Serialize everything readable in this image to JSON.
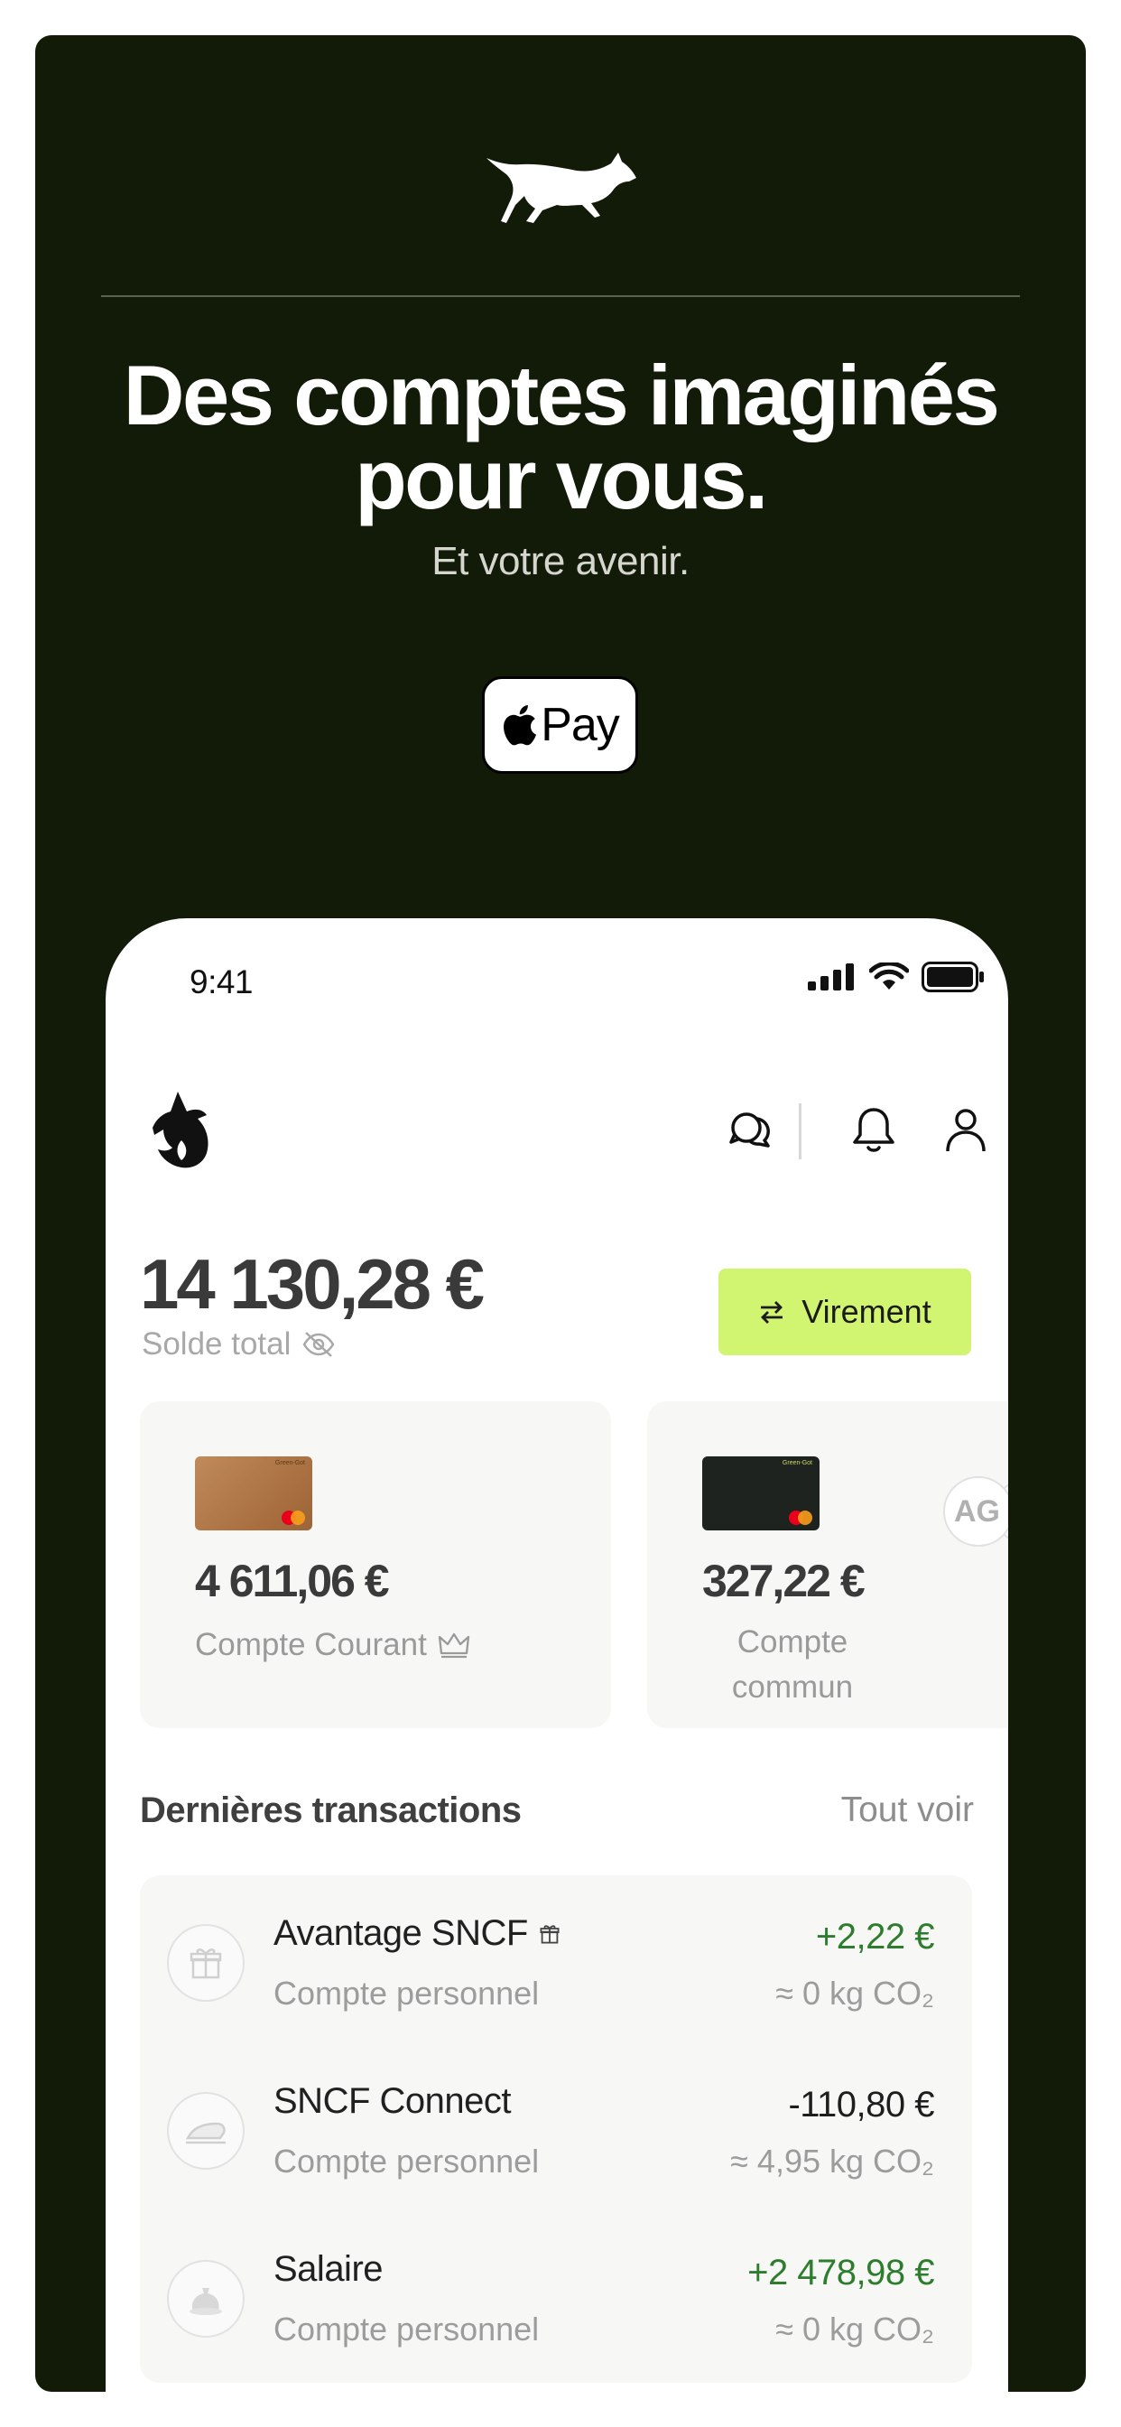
{
  "hero": {
    "title_line1": "Des comptes imaginés",
    "title_line2": "pour vous.",
    "subtitle": "Et votre avenir.",
    "apple_pay_label": "Pay"
  },
  "status_bar": {
    "time": "9:41"
  },
  "app": {
    "balance": "14 130,28 €",
    "balance_label": "Solde total",
    "transfer_button": "Virement",
    "accounts": [
      {
        "amount": "4 611,06 €",
        "name": "Compte Courant",
        "card_brand": "Green-Got"
      },
      {
        "amount": "327,22 €",
        "name_line1": "Compte",
        "name_line2": "commun",
        "card_brand": "Green-Got",
        "avatar_initials": "AG"
      }
    ],
    "transactions_title": "Dernières transactions",
    "see_all": "Tout voir",
    "transactions": [
      {
        "title": "Avantage SNCF",
        "subtitle": "Compte personnel",
        "amount": "+2,22 €",
        "co2": "≈ 0 kg CO₂",
        "icon": "gift-icon",
        "sign": "positive"
      },
      {
        "title": "SNCF Connect",
        "subtitle": "Compte personnel",
        "amount": "-110,80 €",
        "co2": "≈ 4,95 kg CO₂",
        "icon": "train-icon",
        "sign": "negative"
      },
      {
        "title": "Salaire",
        "subtitle": "Compte personnel",
        "amount": "+2 478,98 €",
        "co2": "≈ 0 kg CO₂",
        "icon": "money-bag-icon",
        "sign": "positive"
      }
    ]
  },
  "colors": {
    "background_dark": "#121a08",
    "accent_lime": "#d2f571",
    "positive_green": "#2e7d2e"
  }
}
